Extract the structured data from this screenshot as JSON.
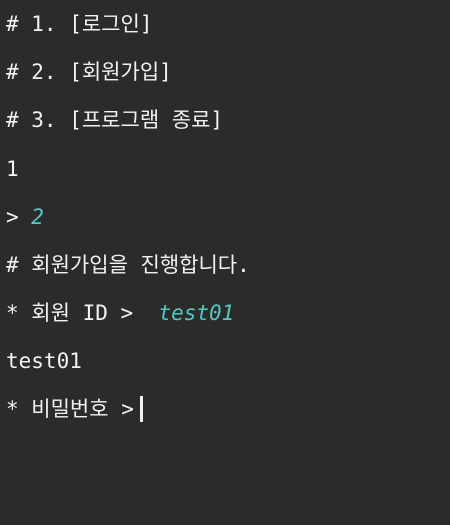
{
  "console": {
    "menu": [
      "# 1. [로그인]",
      "# 2. [회원가입]",
      "# 3. [프로그램 종료]"
    ],
    "echo_1": "1",
    "choice_prompt": "> ",
    "choice_input": "2",
    "signup_message": "# 회원가입을 진행합니다.",
    "id_prompt": "* 회원 ID >  ",
    "id_input": "test01",
    "echo_id": "test01",
    "password_prompt": "* 비밀번호 >"
  },
  "colors": {
    "background": "#2b2b2b",
    "text": "#f2f2f2",
    "user_input": "#57c7c0"
  }
}
